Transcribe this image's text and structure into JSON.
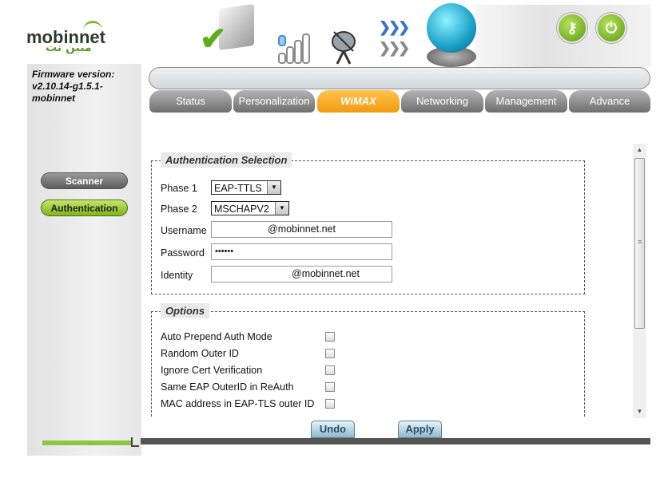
{
  "brand": {
    "logo_en": "mobinnet",
    "logo_ar": "مبين نت"
  },
  "firmware": {
    "label": "Firmware version:",
    "version": "v2.10.14-g1.5.1-mobinnet"
  },
  "sidebar": {
    "items": [
      {
        "label": "Scanner"
      },
      {
        "label": "Authentication"
      }
    ]
  },
  "top_icons": [
    "check-icon",
    "signal-icon",
    "satellite-dish-icon",
    "arrows-icon",
    "globe-icon"
  ],
  "header_buttons": {
    "key": "key-icon",
    "power": "power-icon"
  },
  "tabs": [
    {
      "label": "Status"
    },
    {
      "label": "Personalization"
    },
    {
      "label": "WiMAX",
      "active": true
    },
    {
      "label": "Networking"
    },
    {
      "label": "Management"
    },
    {
      "label": "Advance"
    }
  ],
  "auth": {
    "legend": "Authentication Selection",
    "phase1": {
      "label": "Phase 1",
      "value": "EAP-TTLS"
    },
    "phase2": {
      "label": "Phase 2",
      "value": "MSCHAPV2"
    },
    "username": {
      "label": "Username",
      "value": "@mobinnet.net"
    },
    "password": {
      "label": "Password",
      "value": "••••••"
    },
    "identity": {
      "label": "Identity",
      "value": "@mobinnet.net"
    }
  },
  "options": {
    "legend": "Options",
    "items": [
      {
        "label": "Auto Prepend Auth Mode",
        "checked": false
      },
      {
        "label": "Random Outer ID",
        "checked": false
      },
      {
        "label": "Ignore Cert Verification",
        "checked": false
      },
      {
        "label": "Same EAP OuterID in ReAuth",
        "checked": false
      },
      {
        "label": "MAC address in EAP-TLS outer ID",
        "checked": false
      }
    ]
  },
  "actions": {
    "undo": "Undo",
    "apply": "Apply"
  },
  "colors": {
    "accent_green": "#8dc63f",
    "active_tab": "#f29a10",
    "tab_gray": "#8a8a8a"
  }
}
